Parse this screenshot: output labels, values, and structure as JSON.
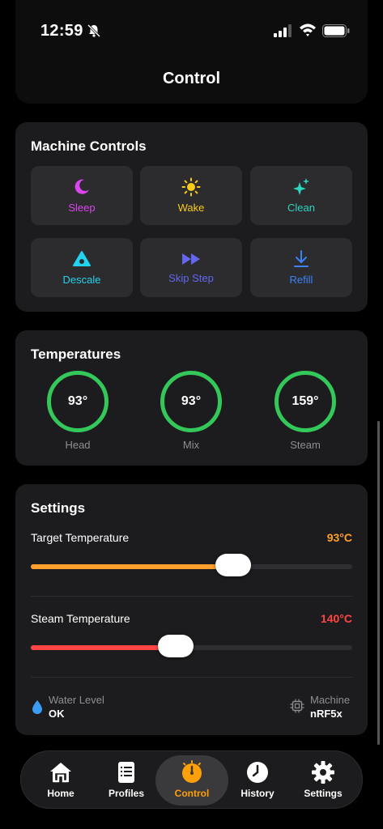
{
  "status_bar": {
    "time": "12:59"
  },
  "header": {
    "title": "Control"
  },
  "machine_controls": {
    "title": "Machine Controls",
    "buttons": [
      {
        "label": "Sleep",
        "color": "#d946ef",
        "icon": "moon-icon"
      },
      {
        "label": "Wake",
        "color": "#facc15",
        "icon": "sun-icon"
      },
      {
        "label": "Clean",
        "color": "#2dd4bf",
        "icon": "sparkles-icon"
      },
      {
        "label": "Descale",
        "color": "#22d3ee",
        "icon": "drop-triangle-icon"
      },
      {
        "label": "Skip Step",
        "color": "#6366f1",
        "icon": "fast-forward-icon"
      },
      {
        "label": "Refill",
        "color": "#3b82f6",
        "icon": "download-arrow-icon"
      }
    ]
  },
  "temperatures": {
    "title": "Temperatures",
    "ring_color": "#34c759",
    "gauges": [
      {
        "value": "93°",
        "label": "Head"
      },
      {
        "value": "93°",
        "label": "Mix"
      },
      {
        "value": "159°",
        "label": "Steam"
      }
    ]
  },
  "settings": {
    "title": "Settings",
    "target_temperature": {
      "label": "Target Temperature",
      "value": "93°C",
      "color": "#ff9f2e",
      "slider_fraction": 0.63
    },
    "steam_temperature": {
      "label": "Steam Temperature",
      "value": "140°C",
      "color": "#ff4545",
      "slider_fraction": 0.45
    },
    "water_level": {
      "label": "Water Level",
      "value": "OK"
    },
    "machine": {
      "label": "Machine",
      "value": "nRF5x"
    }
  },
  "tabs": [
    {
      "label": "Home",
      "icon": "house-icon",
      "active": false
    },
    {
      "label": "Profiles",
      "icon": "document-list-icon",
      "active": false
    },
    {
      "label": "Control",
      "icon": "gauge-icon",
      "active": true,
      "color": "#ff9f0a"
    },
    {
      "label": "History",
      "icon": "clock-icon",
      "active": false
    },
    {
      "label": "Settings",
      "icon": "gear-icon",
      "active": false
    }
  ]
}
